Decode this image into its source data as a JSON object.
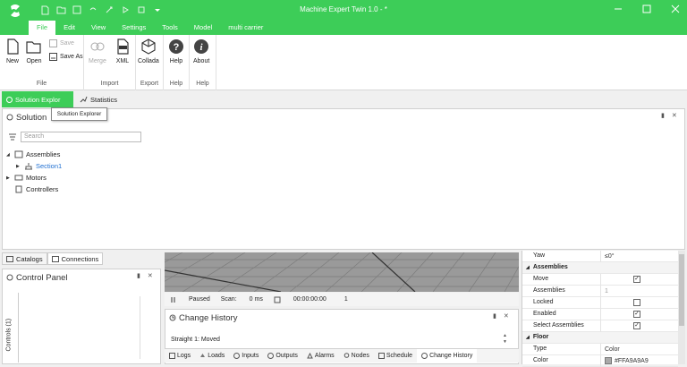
{
  "window": {
    "title": "Machine Expert Twin 1.0 - *"
  },
  "menu": [
    "File",
    "Edit",
    "View",
    "Settings",
    "Tools",
    "Model",
    "multi carrier"
  ],
  "ribbon": {
    "file_group": {
      "label": "File",
      "new": "New",
      "open": "Open",
      "save": "Save",
      "save_as": "Save As"
    },
    "import_group": {
      "label": "Import",
      "merge": "Merge",
      "xml": "XML"
    },
    "export_group": {
      "label": "Export",
      "collada": "Collada"
    },
    "help_group": {
      "label": "Help",
      "help": "Help"
    },
    "about_group": {
      "label": "Help",
      "about": "About"
    }
  },
  "doc_tabs": {
    "solution": "Solution Explor",
    "statistics": "Statistics"
  },
  "tooltip": "Solution Explorer",
  "solution_panel": {
    "title": "Solution",
    "search_placeholder": "Search",
    "tree": {
      "assemblies": "Assemblies",
      "section1": "Section1",
      "motors": "Motors",
      "controllers": "Controllers"
    }
  },
  "bottom_left_tabs": {
    "catalogs": "Catalogs",
    "connections": "Connections"
  },
  "control_panel": {
    "title": "Control Panel",
    "side_label": "Controls (1)"
  },
  "status": {
    "state": "Paused",
    "scan_label": "Scan:",
    "scan_value": "0 ms",
    "time": "00:00:00:00",
    "count": "1"
  },
  "change_history": {
    "title": "Change History",
    "entry": "Straight 1: Moved"
  },
  "bottom_tabs": [
    "Logs",
    "Loads",
    "Inputs",
    "Outputs",
    "Alarms",
    "Nodes",
    "Schedule",
    "Change History"
  ],
  "properties": {
    "yaw": {
      "label": "Yaw",
      "value": "≤0°"
    },
    "assemblies_cat": "Assemblies",
    "move": "Move",
    "assemblies": {
      "label": "Assemblies",
      "value": "1"
    },
    "locked": "Locked",
    "enabled": "Enabled",
    "select_assemblies": "Select Assemblies",
    "floor_cat": "Floor",
    "type": {
      "label": "Type",
      "value": "Color"
    },
    "color": {
      "label": "Color",
      "value": "#FFA9A9A9"
    }
  },
  "colors": {
    "accent": "#3dcd58",
    "link": "#1f6fd1",
    "swatch": "#a9a9a9"
  }
}
